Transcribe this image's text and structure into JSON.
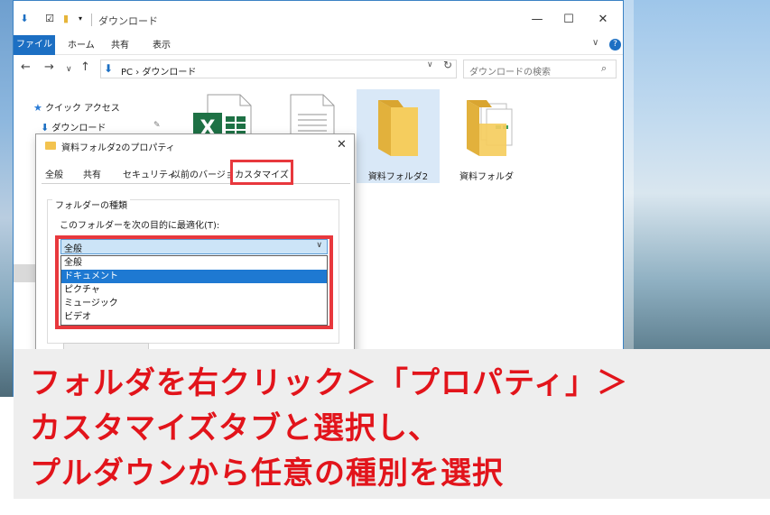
{
  "window": {
    "title": "ダウンロード",
    "ribbon_tabs": [
      "ファイル",
      "ホーム",
      "共有",
      "表示"
    ]
  },
  "address": {
    "path": "PC › ダウンロード",
    "search_placeholder": "ダウンロードの検索"
  },
  "nav_pane": {
    "quick_access": "クイック アクセス",
    "downloads": "ダウンロード"
  },
  "files": [
    {
      "name": "",
      "type": "excel"
    },
    {
      "name": "",
      "type": "document"
    },
    {
      "name": "資料フォルダ2",
      "type": "folder",
      "selected": true
    },
    {
      "name": "資料フォルダ",
      "type": "folder-with-docs"
    }
  ],
  "dialog": {
    "title": "資料フォルダ2のプロパティ",
    "tabs": [
      "全般",
      "共有",
      "セキュリティ",
      "以前のバージョン",
      "カスタマイズ"
    ],
    "active_tab": "カスタマイズ",
    "group_title": "フォルダーの種類",
    "optimize_label": "このフォルダーを次の目的に最適化(T):",
    "selected_value": "全般",
    "options": [
      "全般",
      "ドキュメント",
      "ピクチャ",
      "ミュージック",
      "ビデオ"
    ],
    "highlighted_option": "ドキュメント"
  },
  "callout": {
    "lines": [
      "フォルダを右クリック＞「プロパティ」＞",
      "カスタマイズタブと選択し、",
      "プルダウンから任意の種別を選択"
    ],
    "color": "#e2141b"
  }
}
